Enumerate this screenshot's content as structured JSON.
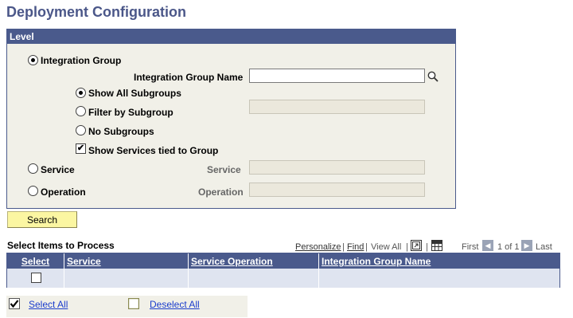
{
  "page": {
    "title": "Deployment Configuration"
  },
  "level": {
    "header": "Level",
    "integration_group_radio": "Integration Group",
    "integration_group_name_label": "Integration Group Name",
    "integration_group_name_value": "",
    "show_all_subgroups": "Show All Subgroups",
    "filter_by_subgroup": "Filter by Subgroup",
    "filter_value": "",
    "no_subgroups": "No Subgroups",
    "show_services_tied": "Show Services tied to Group",
    "service_radio": "Service",
    "service_label": "Service",
    "service_value": "",
    "operation_radio": "Operation",
    "operation_label": "Operation",
    "operation_value": ""
  },
  "search": {
    "label": "Search"
  },
  "grid": {
    "title": "Select Items to Process",
    "personalize": "Personalize",
    "find": "Find",
    "view_all": "View All",
    "first": "First",
    "range": "1 of 1",
    "last": "Last",
    "columns": [
      "Select",
      "Service",
      "Service Operation",
      "Integration Group Name"
    ],
    "rows": [
      {
        "select": "",
        "service": "",
        "service_operation": "",
        "integration_group_name": ""
      }
    ]
  },
  "footer": {
    "select_all": "Select All",
    "deselect_all": "Deselect All"
  },
  "colors": {
    "title": "#4b5789",
    "header_bg": "#4a5a8c",
    "panel_bg": "#f1f0e8",
    "button_bg": "#fbf6a2",
    "row_bg": "#dfe4f0",
    "link": "#1a3ccc"
  },
  "icons": {
    "lookup": "magnifier-icon",
    "zoom": "zoom-icon",
    "download": "grid-download-icon",
    "prev": "arrow-left-icon",
    "next": "arrow-right-icon",
    "check_all": "checkmark-icon",
    "uncheck_all": "empty-box-icon"
  }
}
